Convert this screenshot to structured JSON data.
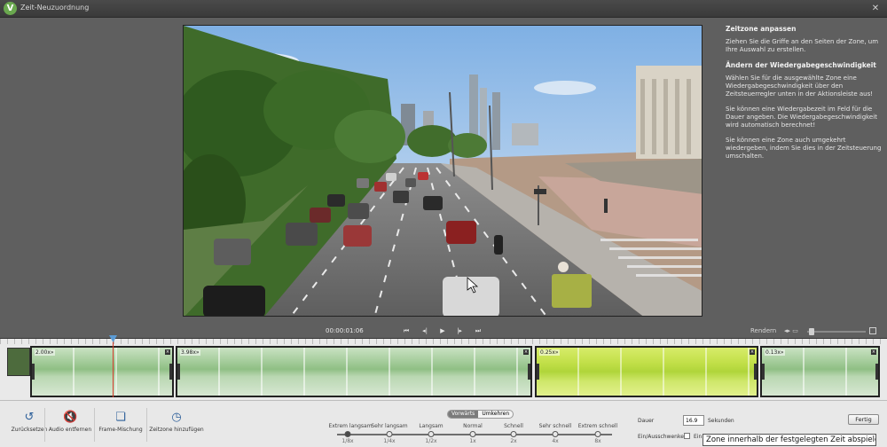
{
  "window": {
    "title": "Zeit-Neuzuordnung",
    "close": "✕",
    "logo": "V"
  },
  "help": {
    "section1_title": "Zeitzone anpassen",
    "section1_text": "Ziehen Sie die Griffe an den Seiten der Zone, um Ihre Auswahl zu erstellen.",
    "section2_title": "Ändern der Wiedergabegeschwindigkeit",
    "section2_text1": "Wählen Sie für die ausgewählte Zone eine Wiedergabegeschwindigkeit über den Zeitsteuerregler unten in der Aktionsleiste aus!",
    "section2_text2": "Sie können eine Wiedergabezeit im Feld für die Dauer angeben. Die Wiedergabegeschwindigkeit wird automatisch berechnet!",
    "section2_text3": "Sie können eine Zone auch umgekehrt wiedergeben, indem Sie dies in der Zeitsteuerung umschalten."
  },
  "transport": {
    "timecode": "00:00:01:06",
    "render": "Rendern",
    "icons": [
      "go-to-start-icon",
      "step-back-icon",
      "play-icon",
      "step-forward-icon",
      "go-to-end-icon"
    ]
  },
  "timeline": {
    "zones": [
      {
        "speed": "2.00x»"
      },
      {
        "speed": "3.98x»"
      },
      {
        "speed": "0.25x»"
      },
      {
        "speed": "0.13x»"
      }
    ]
  },
  "actions": [
    {
      "label": "Zurücksetzen",
      "icon": "reset-icon"
    },
    {
      "label": "Audio entfernen",
      "icon": "mute-icon"
    },
    {
      "label": "Frame-Mischung",
      "icon": "frames-icon"
    },
    {
      "label": "Zeitzone hinzufügen",
      "icon": "clock-icon"
    }
  ],
  "speed_control": {
    "direction": {
      "forward": "Vorwärts",
      "reverse": "Umkehren",
      "active": "forward"
    },
    "stops": [
      {
        "label": "Extrem langsam",
        "value": "1/8x"
      },
      {
        "label": "Sehr langsam",
        "value": "1/4x"
      },
      {
        "label": "Langsam",
        "value": "1/2x"
      },
      {
        "label": "Normal",
        "value": "1x"
      },
      {
        "label": "Schnell",
        "value": "2x"
      },
      {
        "label": "Sehr schnell",
        "value": "4x"
      },
      {
        "label": "Extrem schnell",
        "value": "8x"
      }
    ],
    "active_index": 0
  },
  "duration": {
    "label": "Dauer",
    "value": "16.9",
    "unit": "Sekunden"
  },
  "fade": {
    "label": "Ein/Ausschwenken",
    "option": "Ein"
  },
  "done_button": "Fertig",
  "tooltip": "Zone innerhalb der festgelegten Zeit abspielen"
}
